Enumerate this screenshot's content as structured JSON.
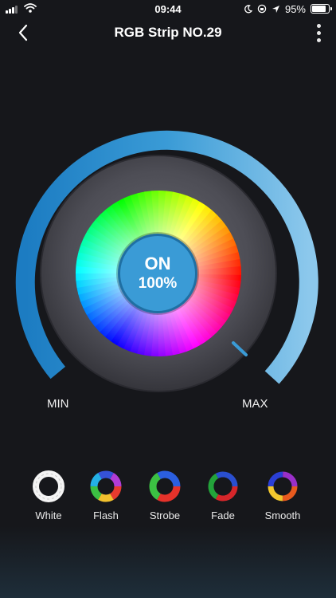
{
  "status_bar": {
    "time": "09:44",
    "battery": "95%"
  },
  "nav": {
    "title": "RGB Strip NO.29"
  },
  "dial": {
    "state": "ON",
    "brightness": "100%",
    "brightness_value": 1.0,
    "min_label": "MIN",
    "max_label": "MAX"
  },
  "modes": [
    {
      "label": "White"
    },
    {
      "label": "Flash"
    },
    {
      "label": "Strobe"
    },
    {
      "label": "Fade"
    },
    {
      "label": "Smooth"
    }
  ],
  "colors": {
    "accent": "#3a9bd6",
    "arc_light": "#7fc3ea",
    "arc_dark": "#1c7cc2",
    "background": "#16171b"
  }
}
